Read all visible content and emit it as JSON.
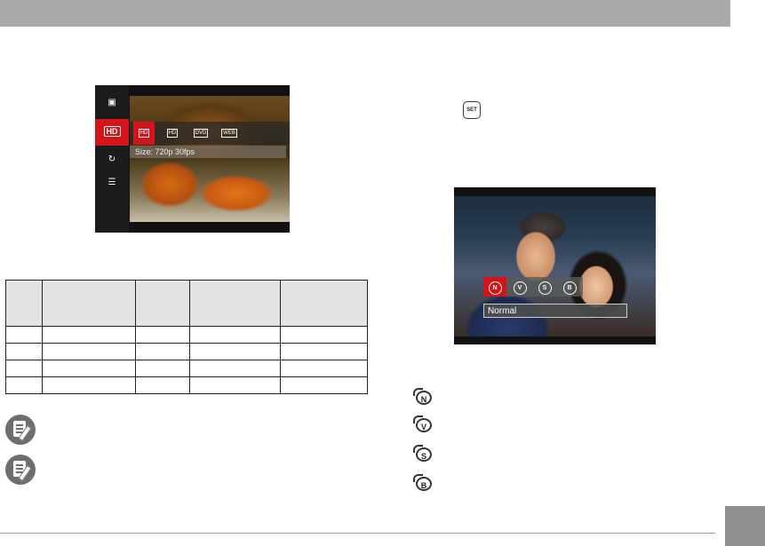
{
  "camera_screen_1": {
    "left_menu": [
      "scene-icon",
      "HD",
      "color-mode-icon",
      "menu-list-icon"
    ],
    "options": [
      {
        "label": "HD",
        "selected": true
      },
      {
        "label": "HD",
        "selected": false
      },
      {
        "label": "DVD",
        "selected": false
      },
      {
        "label": "WEB",
        "selected": false
      }
    ],
    "size_text": "Size: 720p 30fps"
  },
  "set_button_label": "SET",
  "camera_screen_2": {
    "icons": [
      "N",
      "V",
      "S",
      "B"
    ],
    "selected_mode": "Normal"
  },
  "legend_icons": [
    "N",
    "V",
    "S",
    "B"
  ],
  "colors": {
    "accent_red": "#d4141b",
    "header_gray": "#a9a9ab"
  }
}
